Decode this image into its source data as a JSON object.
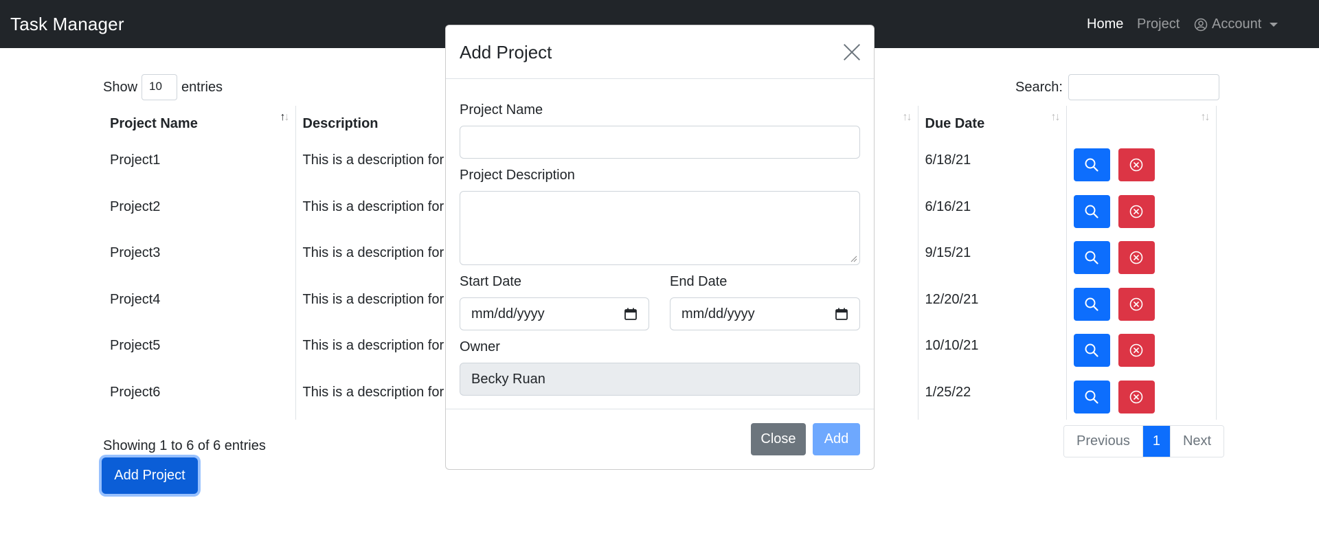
{
  "navbar": {
    "brand": "Task Manager",
    "links": [
      "Home",
      "Project"
    ],
    "account_label": "Account"
  },
  "list_controls": {
    "show_label": "Show",
    "page_length": "10",
    "entries_label": "entries",
    "search_label": "Search:",
    "search_value": ""
  },
  "table": {
    "columns": [
      "Project Name",
      "Description",
      "",
      "Due Date",
      ""
    ],
    "rows": [
      {
        "name": "Project1",
        "description": "This is a description for",
        "due": "6/18/21"
      },
      {
        "name": "Project2",
        "description": "This is a description for",
        "due": "6/16/21"
      },
      {
        "name": "Project3",
        "description": "This is a description for",
        "due": "9/15/21"
      },
      {
        "name": "Project4",
        "description": "This is a description for",
        "due": "12/20/21"
      },
      {
        "name": "Project5",
        "description": "This is a description for",
        "due": "10/10/21"
      },
      {
        "name": "Project6",
        "description": "This is a description for",
        "due": "1/25/22"
      }
    ]
  },
  "footer": {
    "info": "Showing 1 to 6 of 6 entries",
    "previous": "Previous",
    "current_page": "1",
    "next": "Next",
    "add_project": "Add Project"
  },
  "modal": {
    "title": "Add Project",
    "project_name_label": "Project Name",
    "project_name_value": "",
    "description_label": "Project Description",
    "description_value": "",
    "start_date_label": "Start Date",
    "start_date_value": "mm/dd/yyyy",
    "end_date_label": "End Date",
    "end_date_value": "mm/dd/yyyy",
    "owner_label": "Owner",
    "owner_value": "Becky Ruan",
    "close_label": "Close",
    "add_label": "Add"
  },
  "colors": {
    "navbar": "#212529",
    "primary": "#0d6efd",
    "danger": "#dc3545",
    "secondary": "#6c757d"
  }
}
